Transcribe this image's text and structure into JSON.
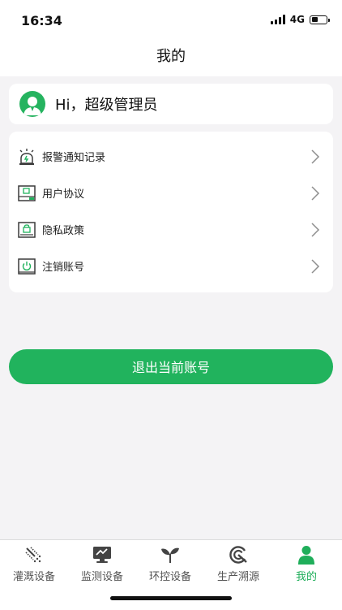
{
  "status_bar": {
    "time": "16:34",
    "network": "4G",
    "battery_level": 0.45
  },
  "header": {
    "title": "我的"
  },
  "profile": {
    "greeting": "Hi，超级管理员",
    "avatar_icon": "user-avatar-icon"
  },
  "menu": {
    "items": [
      {
        "label": "报警通知记录",
        "icon": "alarm-light-icon"
      },
      {
        "label": "用户协议",
        "icon": "agreement-icon"
      },
      {
        "label": "隐私政策",
        "icon": "privacy-lock-icon"
      },
      {
        "label": "注销账号",
        "icon": "power-icon"
      }
    ]
  },
  "logout_label": "退出当前账号",
  "tabs": [
    {
      "label": "灌溉设备",
      "icon": "irrigation-icon",
      "active": false
    },
    {
      "label": "监测设备",
      "icon": "monitor-icon",
      "active": false
    },
    {
      "label": "环控设备",
      "icon": "sprout-icon",
      "active": false
    },
    {
      "label": "生产溯源",
      "icon": "trace-icon",
      "active": false
    },
    {
      "label": "我的",
      "icon": "person-icon",
      "active": true
    }
  ],
  "colors": {
    "accent": "#21b35d",
    "background": "#f4f3f5",
    "tab_inactive": "#555555",
    "icon_dark": "#3a3a3a"
  }
}
